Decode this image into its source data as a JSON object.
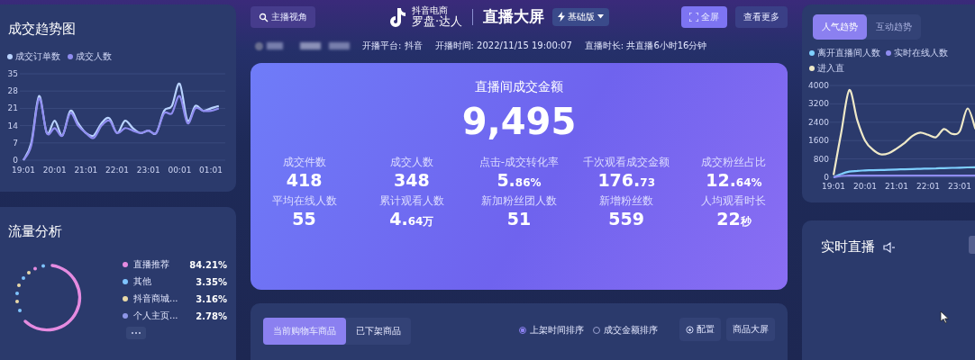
{
  "trade_trend": {
    "title": "成交趋势图",
    "chart_data": {
      "type": "line",
      "grid": true,
      "categories": [
        "19:01",
        null,
        null,
        null,
        "20:01",
        null,
        null,
        null,
        "21:01",
        null,
        null,
        null,
        "22:01",
        null,
        null,
        null,
        "23:01",
        null,
        null,
        null,
        "00:01",
        null,
        null,
        null,
        "01:01",
        null
      ],
      "ylim": [
        0,
        35
      ],
      "yticks": [
        0,
        7,
        14,
        21,
        28,
        35
      ],
      "series": [
        {
          "name": "成交订单数",
          "color": "#b9d3ff",
          "values": [
            0,
            7,
            26,
            11,
            16,
            10,
            20,
            15,
            11,
            10,
            15,
            17,
            11,
            16,
            13,
            11,
            12,
            11,
            20,
            22,
            31,
            16,
            22,
            20,
            21,
            22
          ]
        },
        {
          "name": "成交人数",
          "color": "#8f8cf0",
          "values": [
            0,
            6,
            25,
            11,
            13,
            10,
            19,
            14,
            11,
            9,
            14,
            16,
            11,
            13,
            12,
            11,
            12,
            11,
            19,
            19,
            26,
            15,
            21,
            20,
            20,
            21
          ]
        }
      ]
    }
  },
  "traffic": {
    "title": "流量分析",
    "legend": [
      {
        "name": "直播推荐",
        "value": "84.21%",
        "color": "#e58be0"
      },
      {
        "name": "其他",
        "value": "3.35%",
        "color": "#7fc4ff"
      },
      {
        "name": "抖音商城...",
        "value": "3.16%",
        "color": "#e9d9a8"
      },
      {
        "name": "个人主页...",
        "value": "2.78%",
        "color": "#8e96e8"
      }
    ]
  },
  "header": {
    "anchor_view_button": "主播视角",
    "logo_caption": "抖音电商",
    "logo_name": "罗盘·达人",
    "title": "直播大屏",
    "edition": "基础版",
    "fullscreen_button": "全屏",
    "more_button": "查看更多"
  },
  "live_info": {
    "platform": "开播平台: 抖音",
    "start_time": "开播时间: 2022/11/15 19:00:07",
    "duration": "直播时长: 共直播6小时16分钟"
  },
  "gmv": {
    "label": "直播间成交金额",
    "value": "9,495",
    "metrics": [
      {
        "label": "成交件数",
        "value": "418"
      },
      {
        "label": "成交人数",
        "value": "348"
      },
      {
        "label": "点击-成交转化率",
        "value": "5.",
        "small": "86%"
      },
      {
        "label": "千次观看成交金额",
        "value": "176.",
        "small": "73"
      },
      {
        "label": "成交粉丝占比",
        "value": "12.",
        "small": "64%"
      },
      {
        "label": "平均在线人数",
        "value": "55"
      },
      {
        "label": "累计观看人数",
        "value": "4.",
        "small": "64万"
      },
      {
        "label": "新加粉丝团人数",
        "value": "51"
      },
      {
        "label": "新增粉丝数",
        "value": "559"
      },
      {
        "label": "人均观看时长",
        "value": "22",
        "small": "秒"
      }
    ]
  },
  "products": {
    "tabs": [
      {
        "label": "当前购物车商品",
        "selected": true
      },
      {
        "label": "已下架商品",
        "selected": false
      }
    ],
    "sort_options": [
      {
        "label": "上架时间排序",
        "selected": true
      },
      {
        "label": "成交金额排序",
        "selected": false
      }
    ],
    "config_button": "配置",
    "product_screen_button": "商品大屏"
  },
  "trend": {
    "tabs": [
      {
        "label": "人气趋势",
        "selected": true
      },
      {
        "label": "互动趋势",
        "selected": false
      }
    ],
    "chart_data": {
      "type": "line",
      "grid": true,
      "categories": [
        "19:01",
        null,
        null,
        null,
        "20:01",
        null,
        null,
        null,
        "21:01",
        null,
        null,
        null,
        "22:01",
        null,
        null,
        null,
        "23:01",
        null,
        null
      ],
      "ylim": [
        0,
        4000
      ],
      "yticks": [
        0,
        800,
        1600,
        2400,
        3200,
        4000
      ],
      "series": [
        {
          "name": "离开直播间人数",
          "color": "#7fd0ff",
          "values": [
            0,
            150,
            250,
            280,
            300,
            310,
            320,
            330,
            340,
            350,
            360,
            370,
            380,
            390,
            400,
            410,
            420,
            430,
            440
          ]
        },
        {
          "name": "实时在线人数",
          "color": "#8f8cf0",
          "values": [
            0,
            60,
            70,
            70,
            70,
            70,
            70,
            70,
            70,
            70,
            70,
            70,
            70,
            70,
            70,
            70,
            70,
            70,
            70
          ]
        },
        {
          "name": "进入直",
          "color": "#efe9c8",
          "values": [
            100,
            2000,
            3800,
            2500,
            1600,
            1200,
            1000,
            1050,
            1250,
            1500,
            1800,
            1950,
            1850,
            1750,
            2100,
            1900,
            2000,
            3000,
            2100
          ]
        }
      ]
    }
  },
  "live": {
    "title": "实时直播"
  }
}
